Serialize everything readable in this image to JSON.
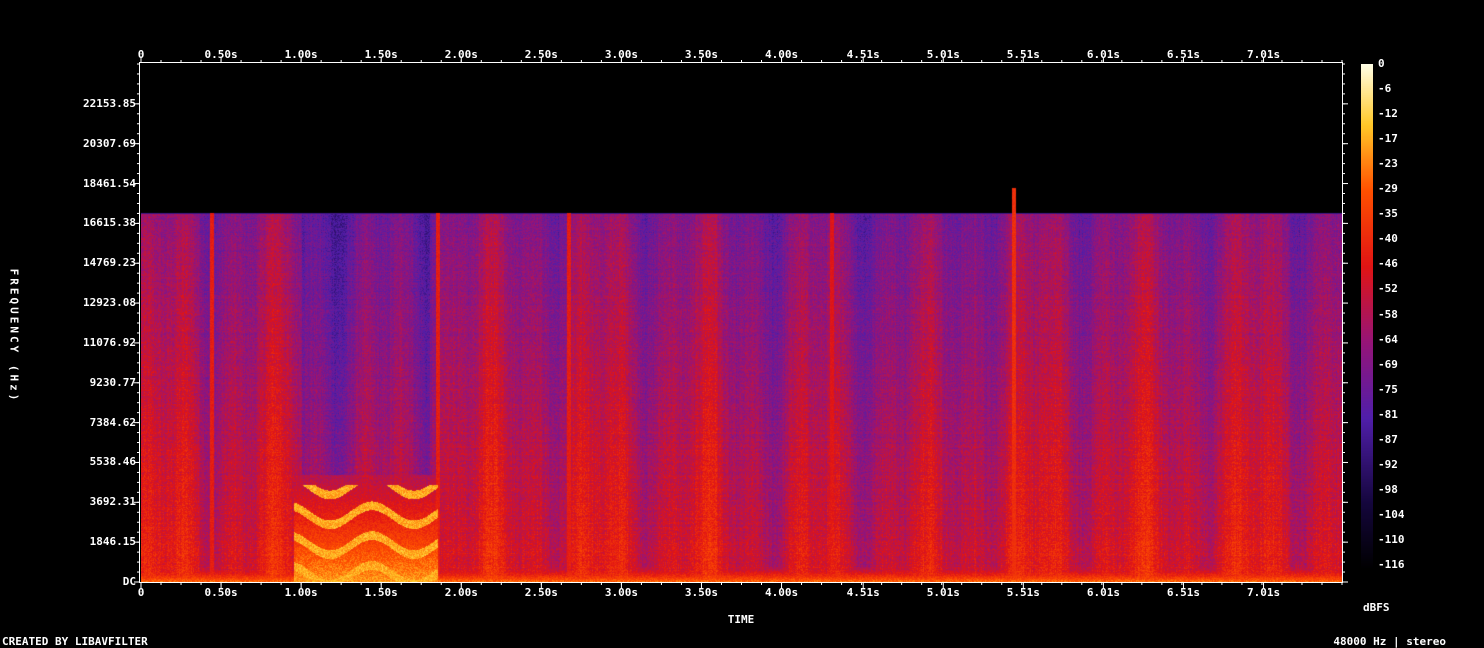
{
  "chart_data": {
    "type": "heatmap",
    "title": "",
    "xlabel": "TIME",
    "ylabel": "FREQUENCY (Hz)",
    "x_ticks": [
      "0",
      "0.50s",
      "1.00s",
      "1.50s",
      "2.00s",
      "2.50s",
      "3.00s",
      "3.50s",
      "4.00s",
      "4.51s",
      "5.01s",
      "5.51s",
      "6.01s",
      "6.51s",
      "7.01s"
    ],
    "x_tick_values": [
      0,
      0.5,
      1.0,
      1.5,
      2.0,
      2.5,
      3.0,
      3.5,
      4.0,
      4.51,
      5.01,
      5.51,
      6.01,
      6.51,
      7.01
    ],
    "xlim": [
      0,
      7.5
    ],
    "y_ticks": [
      "DC",
      "1846.15",
      "3692.31",
      "5538.46",
      "7384.62",
      "9230.77",
      "11076.92",
      "12923.08",
      "14769.23",
      "16615.38",
      "18461.54",
      "20307.69",
      "22153.85"
    ],
    "y_tick_values": [
      0,
      1846.15,
      3692.31,
      5538.46,
      7384.62,
      9230.77,
      11076.92,
      12923.08,
      14769.23,
      16615.38,
      18461.54,
      20307.69,
      22153.85
    ],
    "ylim": [
      0,
      24000
    ],
    "colorbar": {
      "label": "dBFS",
      "ticks": [
        "0",
        "-6",
        "-12",
        "-17",
        "-23",
        "-29",
        "-35",
        "-40",
        "-46",
        "-52",
        "-58",
        "-64",
        "-69",
        "-75",
        "-81",
        "-87",
        "-92",
        "-98",
        "-104",
        "-110",
        "-116"
      ],
      "range": [
        -120,
        0
      ]
    },
    "cutoff_frequency_hz": 17100,
    "bright_regions": [
      {
        "time_start": 0.95,
        "time_end": 1.85,
        "freq_low": 0,
        "freq_high": 5000,
        "level_dbfs": -20
      },
      {
        "time_start": 0,
        "time_end": 7.5,
        "freq_low": 0,
        "freq_high": 700,
        "level_dbfs": -25
      }
    ],
    "vertical_transients": [
      {
        "time": 0.44,
        "level_dbfs": -45
      },
      {
        "time": 1.85,
        "level_dbfs": -45
      },
      {
        "time": 2.67,
        "level_dbfs": -45
      },
      {
        "time": 4.31,
        "level_dbfs": -48
      },
      {
        "time": 5.45,
        "level_dbfs": -40
      }
    ]
  },
  "footer": {
    "left": "CREATED BY LIBAVFILTER",
    "right": "48000 Hz | stereo"
  },
  "colors": {
    "background": "#000000",
    "axis": "#ffffff"
  }
}
